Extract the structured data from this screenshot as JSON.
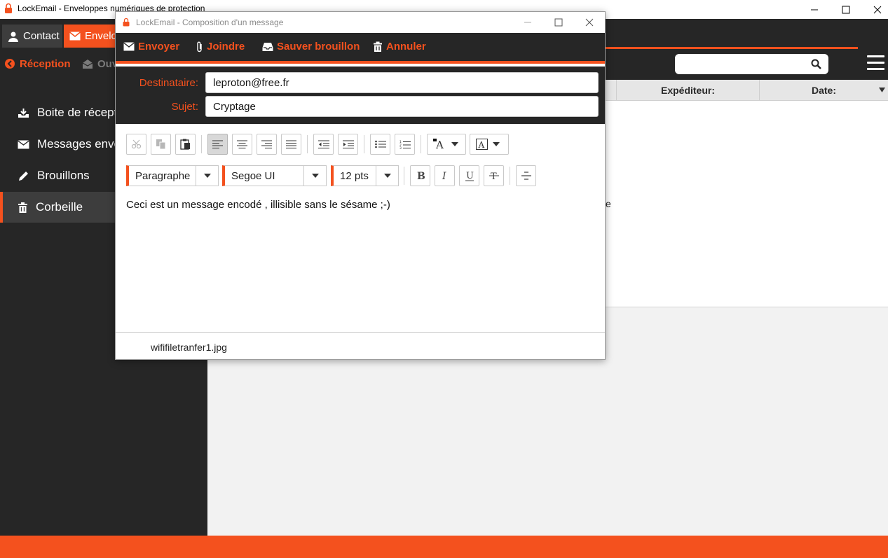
{
  "main_window": {
    "title": "LockEmail - Enveloppes numériques de protection",
    "tabs": [
      {
        "label": "Contact"
      },
      {
        "label": "Envelop"
      }
    ],
    "toolbar": {
      "reception_label": "Réception",
      "second_label": "Ouv"
    },
    "search": {
      "placeholder": ""
    },
    "sidebar": {
      "items": [
        {
          "label": "Boite de réceptio",
          "icon": "inbox-icon"
        },
        {
          "label": "Messages envoy",
          "icon": "sent-icon"
        },
        {
          "label": "Brouillons",
          "icon": "pencil-icon"
        },
        {
          "label": "Corbeille",
          "icon": "trash-icon",
          "active": true
        }
      ]
    },
    "list_columns": [
      "Expéditeur:",
      "Date:"
    ],
    "list_peek_text": "e"
  },
  "compose": {
    "title": "LockEmail - Composition d'un message",
    "toolbar": {
      "send": "Envoyer",
      "attach": "Joindre",
      "save_draft": "Sauver brouillon",
      "cancel": "Annuler"
    },
    "to_label": "Destinataire:",
    "to_value": "leproton@free.fr",
    "subject_label": "Sujet:",
    "subject_value": "Cryptage",
    "format": {
      "paragraph": "Paragraphe",
      "font": "Segoe UI",
      "size": "12 pts"
    },
    "body": "Ceci est un message encodé , illisible sans le sésame  ;-)",
    "attachment": "wififiletranfer1.jpg"
  },
  "colors": {
    "accent": "#f4511e",
    "dark": "#262626",
    "dark_active": "#3d3d3d"
  }
}
